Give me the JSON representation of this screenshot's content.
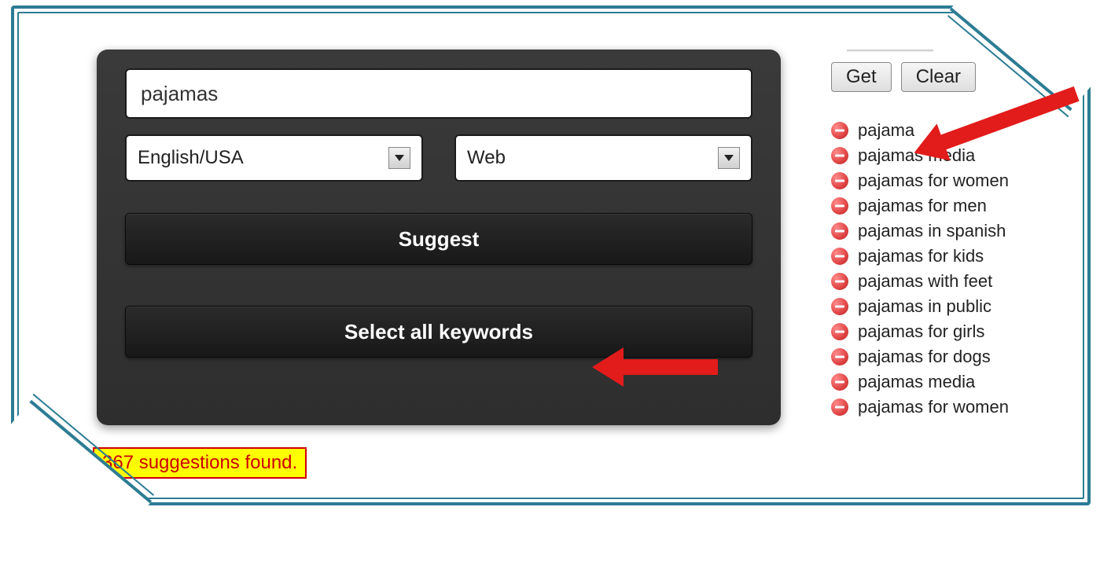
{
  "panel": {
    "keyword_value": "pajamas",
    "language_label": "English/USA",
    "source_label": "Web",
    "suggest_label": "Suggest",
    "select_all_label": "Select all keywords"
  },
  "status": {
    "text": "367 suggestions found."
  },
  "sidebar": {
    "get_label": "Get",
    "clear_label": "Clear",
    "keywords": [
      "pajama",
      "pajamas media",
      "pajamas for women",
      "pajamas for men",
      "pajamas in spanish",
      "pajamas for kids",
      "pajamas with feet",
      "pajamas in public",
      "pajamas for girls",
      "pajamas for dogs",
      "pajamas media",
      "pajamas for women"
    ]
  }
}
